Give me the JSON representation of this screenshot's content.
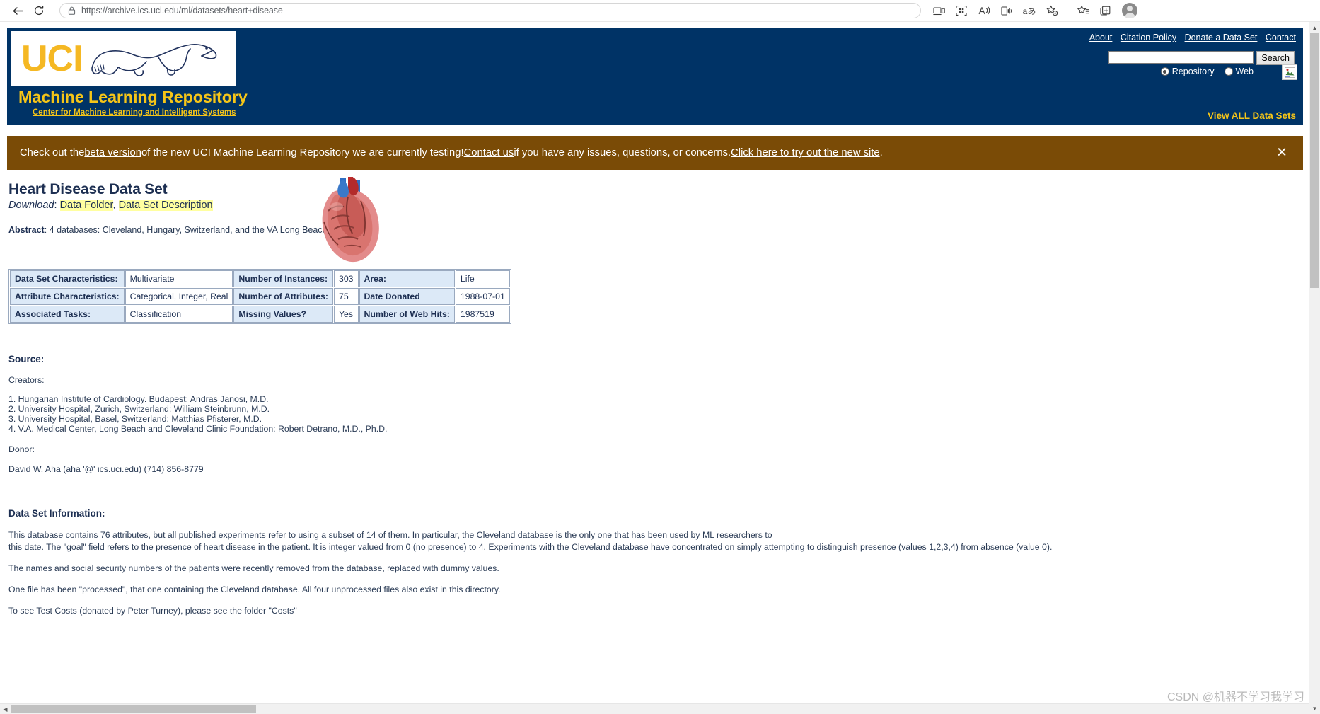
{
  "browser": {
    "back_label": "back-arrow",
    "reload_label": "reload",
    "url_prefix": "https://",
    "url_host": "archive.ics.uci.edu",
    "url_path": "/ml/datasets/heart+disease",
    "url_full": "https://archive.ics.uci.edu/ml/datasets/heart+disease",
    "toolbar_icons": [
      "device-cast-icon",
      "app-grid-icon",
      "read-aloud-icon",
      "immersive-reader-icon",
      "translate-icon",
      "add-to-collections-icon",
      "favorites-icon",
      "collections-icon"
    ],
    "profile_label": "profile-avatar"
  },
  "header": {
    "logo_text": "UCI",
    "title": "Machine Learning Repository",
    "subtitle": "Center for Machine Learning and Intelligent Systems",
    "nav_links": [
      "About",
      "Citation Policy",
      "Donate a Data Set",
      "Contact"
    ],
    "search": {
      "value": "",
      "placeholder": "",
      "button_label": "Search",
      "options": [
        "Repository",
        "Web"
      ],
      "selected": "Repository"
    },
    "view_all_label": "View ALL Data Sets"
  },
  "banner": {
    "text_1": "Check out the ",
    "link_1": "beta version",
    "text_2": " of the new UCI Machine Learning Repository we are currently testing! ",
    "link_2": "Contact us",
    "text_3": " if you have any issues, questions, or concerns. ",
    "link_3": "Click here to try out the new site",
    "text_4": ".",
    "close_label": "✕"
  },
  "dataset": {
    "title": "Heart Disease Data Set",
    "download_label": "Download",
    "download_sep": ": ",
    "link_data_folder": "Data Folder",
    "link_comma": ", ",
    "link_description": "Data Set Description",
    "abstract_label": "Abstract",
    "abstract_text": ": 4 databases: Cleveland, Hungary, Switzerland, and the VA Long Beach"
  },
  "info_table": {
    "rows": [
      {
        "label_a": "Data Set Characteristics:",
        "value_a": "Multivariate",
        "label_b": "Number of Instances:",
        "value_b": "303",
        "label_c": "Area:",
        "value_c": "Life"
      },
      {
        "label_a": "Attribute Characteristics:",
        "value_a": "Categorical, Integer, Real",
        "label_b": "Number of Attributes:",
        "value_b": "75",
        "label_c": "Date Donated",
        "value_c": "1988-07-01"
      },
      {
        "label_a": "Associated Tasks:",
        "value_a": "Classification",
        "label_b": "Missing Values?",
        "value_b": "Yes",
        "label_c": "Number of Web Hits:",
        "value_c": "1987519"
      }
    ]
  },
  "source": {
    "heading": "Source:",
    "creators_label": "Creators:",
    "creators": [
      "1. Hungarian Institute of Cardiology. Budapest: Andras Janosi, M.D.",
      "2. University Hospital, Zurich, Switzerland: William Steinbrunn, M.D.",
      "3. University Hospital, Basel, Switzerland: Matthias Pfisterer, M.D.",
      "4. V.A. Medical Center, Long Beach and Cleveland Clinic Foundation: Robert Detrano, M.D., Ph.D."
    ],
    "donor_label": "Donor:",
    "donor_name": "David W. Aha (",
    "donor_email": "aha '@' ics.uci.edu",
    "donor_phone": ") (714) 856-8779"
  },
  "dataset_info": {
    "heading": "Data Set Information:",
    "paragraphs": [
      "This database contains 76 attributes, but all published experiments refer to using a subset of 14 of them. In particular, the Cleveland database is the only one that has been used by ML researchers to",
      "this date. The \"goal\" field refers to the presence of heart disease in the patient. It is integer valued from 0 (no presence) to 4. Experiments with the Cleveland database have concentrated on simply attempting to distinguish presence (values 1,2,3,4) from absence (value 0).",
      "The names and social security numbers of the patients were recently removed from the database, replaced with dummy values.",
      "One file has been \"processed\", that one containing the Cleveland database. All four unprocessed files also exist in this directory.",
      "To see Test Costs (donated by Peter Turney), please see the folder \"Costs\""
    ]
  },
  "watermark": {
    "text": "CSDN @机器不学习我学习"
  },
  "colors": {
    "header_blue": "#003366",
    "gold": "#F5C518",
    "banner_brown": "#7a4b06",
    "table_header": "#dce9f7",
    "highlight_yellow": "#ffffa0"
  }
}
